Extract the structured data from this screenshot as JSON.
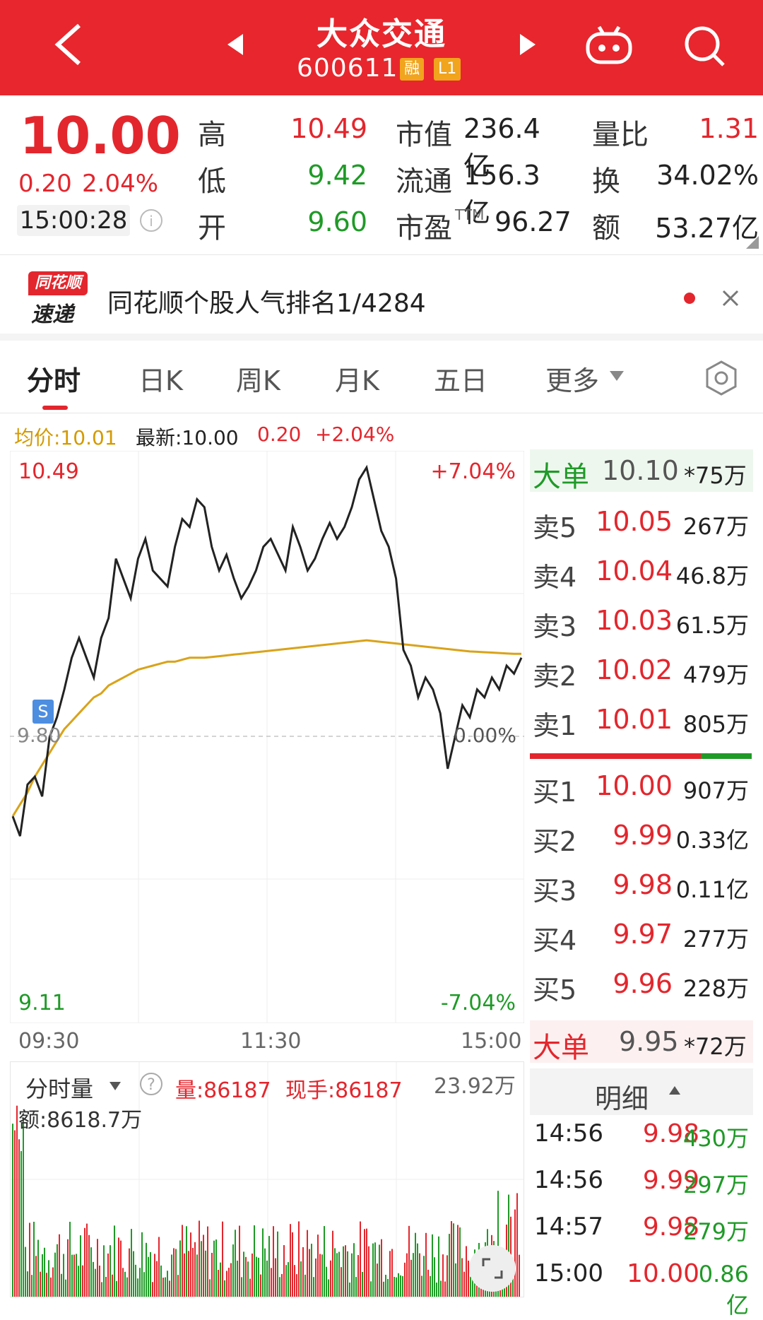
{
  "header": {
    "title": "大众交通",
    "code": "600611",
    "tag_margin": "融",
    "tag_level": "L1"
  },
  "quote": {
    "price": "10.00",
    "change": "0.20",
    "change_pct": "2.04%",
    "time": "15:00:28",
    "high_label": "高",
    "high": "10.49",
    "low_label": "低",
    "low": "9.42",
    "open_label": "开",
    "open": "9.60",
    "mcap_label": "市值",
    "mcap": "236.4亿",
    "float_label": "流通",
    "float": "156.3亿",
    "pe_label": "市盈",
    "pe_sup": "TTM",
    "pe": "96.27",
    "vr_label": "量比",
    "vr": "1.31",
    "turnover_label": "换",
    "turnover": "34.02%",
    "amount_label": "额",
    "amount": "53.27亿"
  },
  "banner": {
    "logo_top": "同花顺",
    "logo_bottom": "速递",
    "text": "同花顺个股人气排名1/4284"
  },
  "tabs": [
    "分时",
    "日K",
    "周K",
    "月K",
    "五日",
    "更多"
  ],
  "chart_info": {
    "avg_label": "均价:10.01",
    "latest_label": "最新:10.00",
    "change": "0.20",
    "change_pct": "+2.04%"
  },
  "chart_data": {
    "type": "line",
    "y_top": "10.49",
    "y_mid": "9.80",
    "y_bottom": "9.11",
    "pct_top": "+7.04%",
    "pct_mid": "0.00%",
    "pct_bottom": "-7.04%",
    "x_ticks": [
      "09:30",
      "11:30",
      "15:00"
    ],
    "ylim": [
      9.11,
      10.49
    ],
    "prev_close": 9.8,
    "series": [
      {
        "values": [
          9.6,
          9.55,
          9.68,
          9.7,
          9.65,
          9.8,
          9.85,
          9.92,
          10.0,
          10.05,
          10.0,
          9.95,
          10.05,
          10.1,
          10.25,
          10.2,
          10.15,
          10.25,
          10.3,
          10.22,
          10.2,
          10.18,
          10.28,
          10.35,
          10.33,
          10.4,
          10.38,
          10.28,
          10.22,
          10.26,
          10.2,
          10.15,
          10.18,
          10.22,
          10.28,
          10.3,
          10.26,
          10.22,
          10.33,
          10.28,
          10.22,
          10.25,
          10.3,
          10.34,
          10.3,
          10.33,
          10.38,
          10.45,
          10.48,
          10.4,
          10.32,
          10.28,
          10.2,
          10.02,
          9.98,
          9.9,
          9.95,
          9.92,
          9.86,
          9.72,
          9.8,
          9.88,
          9.85,
          9.92,
          9.9,
          9.95,
          9.92,
          9.98,
          9.96,
          10.0
        ]
      },
      {
        "values": [
          9.6,
          9.63,
          9.66,
          9.7,
          9.73,
          9.76,
          9.79,
          9.82,
          9.84,
          9.86,
          9.88,
          9.9,
          9.91,
          9.93,
          9.94,
          9.95,
          9.96,
          9.97,
          9.975,
          9.98,
          9.985,
          9.99,
          9.99,
          9.995,
          10.0,
          10.0,
          10.0,
          10.002,
          10.004,
          10.006,
          10.008,
          10.01,
          10.012,
          10.014,
          10.016,
          10.018,
          10.02,
          10.022,
          10.024,
          10.026,
          10.028,
          10.03,
          10.032,
          10.034,
          10.036,
          10.038,
          10.04,
          10.042,
          10.044,
          10.042,
          10.04,
          10.038,
          10.036,
          10.034,
          10.032,
          10.03,
          10.028,
          10.026,
          10.024,
          10.022,
          10.02,
          10.018,
          10.016,
          10.015,
          10.014,
          10.013,
          10.012,
          10.011,
          10.01,
          10.01
        ]
      }
    ]
  },
  "order_book": {
    "big_sell": {
      "label": "大单",
      "price": "10.10",
      "vol": "*75万"
    },
    "asks": [
      {
        "label": "卖5",
        "price": "10.05",
        "vol": "267万"
      },
      {
        "label": "卖4",
        "price": "10.04",
        "vol": "46.8万"
      },
      {
        "label": "卖3",
        "price": "10.03",
        "vol": "61.5万"
      },
      {
        "label": "卖2",
        "price": "10.02",
        "vol": "479万"
      },
      {
        "label": "卖1",
        "price": "10.01",
        "vol": "805万"
      }
    ],
    "bids": [
      {
        "label": "买1",
        "price": "10.00",
        "vol": "907万"
      },
      {
        "label": "买2",
        "price": "9.99",
        "vol": "0.33亿"
      },
      {
        "label": "买3",
        "price": "9.98",
        "vol": "0.11亿"
      },
      {
        "label": "买4",
        "price": "9.97",
        "vol": "277万"
      },
      {
        "label": "买5",
        "price": "9.96",
        "vol": "228万"
      }
    ],
    "big_buy": {
      "label": "大单",
      "price": "9.95",
      "vol": "*72万"
    },
    "detail_label": "明细"
  },
  "details": [
    {
      "time": "14:56",
      "price": "9.98",
      "vol": "430万"
    },
    {
      "time": "14:56",
      "price": "9.99",
      "vol": "297万"
    },
    {
      "time": "14:57",
      "price": "9.98",
      "vol": "279万"
    },
    {
      "time": "15:00",
      "price": "10.00",
      "vol": "0.86亿"
    }
  ],
  "volume_panel": {
    "title": "分时量",
    "vol_label": "量:86187",
    "hand_label": "现手:86187",
    "max_label": "23.92万",
    "amount_label": "额:8618.7万"
  }
}
